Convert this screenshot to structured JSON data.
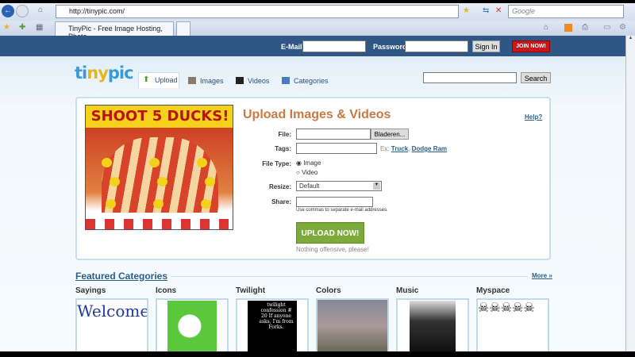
{
  "browser": {
    "url": "http://tinypic.com/",
    "search_placeholder": "Google",
    "tab_title": "TinyPic - Free Image Hosting, Photo ..."
  },
  "header": {
    "email_label": "E-Mail:",
    "password_label": "Password:",
    "signin": "Sign In",
    "join": "JOIN NOW!",
    "search_button": "Search"
  },
  "logo": "tinypic",
  "nav": [
    {
      "label": "Upload"
    },
    {
      "label": "Images"
    },
    {
      "label": "Videos"
    },
    {
      "label": "Categories"
    }
  ],
  "ad": {
    "title": "SHOOT 5 DUCKS!"
  },
  "form": {
    "title": "Upload Images & Videos",
    "help": "Help?",
    "file_label": "File:",
    "browse": "Bladeren...",
    "tags_label": "Tags:",
    "tags_ex": "Ex:",
    "tags_ex1": "Truck",
    "tags_ex2": "Dodge Ram",
    "filetype_label": "File Type:",
    "opt_image": "Image",
    "opt_video": "Video",
    "resize_label": "Resize:",
    "resize_value": "Default",
    "share_label": "Share:",
    "share_hint": "Use commas to separate e-mail addresses.",
    "upload": "UPLOAD NOW!",
    "note": "Nothing offensive, please!"
  },
  "featured": {
    "title": "Featured Categories",
    "more": "More »",
    "categories": [
      {
        "name": "Sayings",
        "thumb_text": "Welcome"
      },
      {
        "name": "Icons"
      },
      {
        "name": "Twilight",
        "thumb_text": "twilight confession # 20 If anyone asks, I'm from Forks."
      },
      {
        "name": "Colors"
      },
      {
        "name": "Music"
      },
      {
        "name": "Myspace",
        "thumb_text": "☠☠☠☠☠"
      }
    ]
  }
}
